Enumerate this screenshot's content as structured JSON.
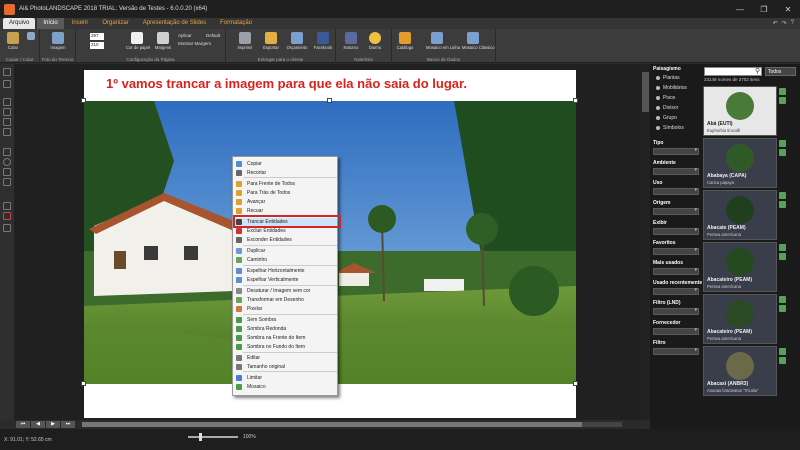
{
  "window": {
    "title": "Ai& PhotoLANDSCAPE 2018 TRIAL: Versão de Testes - 6.0.0.20 (x64)",
    "controls": [
      "—",
      "❐",
      "✕"
    ]
  },
  "menubar": {
    "tabs": [
      "Arquivo",
      "Início",
      "Inserir",
      "Organizar",
      "Apresentação de Slides",
      "Formatação"
    ],
    "active": "Início",
    "right_icons": [
      "↶",
      "↷",
      "?"
    ]
  },
  "ribbon": {
    "groups": [
      {
        "label": "Copiar / Colar",
        "buttons": [
          "Colar",
          "Copiar"
        ]
      },
      {
        "label": "Foto do Terreno",
        "buttons": [
          "Imagem"
        ]
      },
      {
        "label": "Configuração da Página",
        "buttons": [
          "Cor de papel",
          "Margens",
          "Aplicar",
          "Mostrar Margem",
          "Default"
        ],
        "width_value": "297",
        "height_value": "210"
      },
      {
        "label": "Entregar para o cliente",
        "buttons": [
          "Imprimir",
          "Exportar",
          "Orçamento",
          "Facebook"
        ]
      },
      {
        "label": "Noite/Dia",
        "buttons": [
          "Noturno",
          "Diurno"
        ]
      },
      {
        "label": "Banco de Dados",
        "buttons": [
          "Catálogo",
          "Mosaico em Linha",
          "Mosaico Clássico"
        ]
      }
    ]
  },
  "canvas": {
    "caption": "1º vamos trancar a imagem para que ela não saia do lugar."
  },
  "context_menu": {
    "items": [
      {
        "label": "Copiar",
        "color": "#4a90d9"
      },
      {
        "label": "Recortar",
        "color": "#666666"
      },
      {
        "label": "Para Frente de Todos",
        "color": "#e0a030"
      },
      {
        "label": "Para Trás de Todos",
        "color": "#e0a030"
      },
      {
        "label": "Avançar",
        "color": "#e0a030"
      },
      {
        "label": "Recuar",
        "color": "#e0a030"
      },
      {
        "label": "Trancar Entidades",
        "color": "#444444",
        "highlighted": true
      },
      {
        "label": "Excluir Entidades",
        "color": "#cc3333"
      },
      {
        "label": "Esconder Entidades",
        "color": "#666666"
      },
      {
        "label": "Duplicar",
        "color": "#6a9ad6"
      },
      {
        "label": "Caminho",
        "color": "#6aa060"
      },
      {
        "label": "Espelhar Horizontalmente",
        "color": "#5a8fd0"
      },
      {
        "label": "Espelhar Verticalmente",
        "color": "#5a8fd0"
      },
      {
        "label": "Desaturar / Imagem sem cor",
        "color": "#888888"
      },
      {
        "label": "Transformar em Desenho",
        "color": "#6aa060"
      },
      {
        "label": "Pixelar",
        "color": "#d07a3a"
      },
      {
        "label": "Sem Sombra",
        "color": "#4a9a4a"
      },
      {
        "label": "Sombra Redonda",
        "color": "#4a9a4a"
      },
      {
        "label": "Sombra na Frente do Item",
        "color": "#4a9a4a"
      },
      {
        "label": "Sombra no Fundo do Item",
        "color": "#4a9a4a"
      },
      {
        "label": "Editar",
        "color": "#777777"
      },
      {
        "label": "Tamanho original",
        "color": "#777777"
      },
      {
        "label": "Limitar",
        "color": "#4a7fcf"
      },
      {
        "label": "Mosaico",
        "color": "#4a9a4a"
      }
    ]
  },
  "side_panel": {
    "paisagismo_label": "Paisagismo",
    "categories": [
      "Plantas",
      "Mobiliários",
      "Pisos",
      "Divisor",
      "Grupo",
      "Símbolos"
    ],
    "filters": [
      "Tipo",
      "Ambiente",
      "Uso",
      "Origem",
      "Exibir",
      "Favoritos",
      "Mais usados",
      "Usado recentemente",
      "Filtro (LND)",
      "Fornecedor",
      "Filtro"
    ],
    "search_placeholder": "",
    "scope": "Todos",
    "count_text": "23149 nomes de 2702 itens",
    "items": [
      {
        "name": "Abá (EUTI)",
        "scientific": "Euphorbia tirucalli",
        "selected": true
      },
      {
        "name": "Ababaya (CAPA)",
        "scientific": "Carica papaya",
        "selected": false
      },
      {
        "name": "Abacate (PEAM)",
        "scientific": "Persea americana",
        "selected": false
      },
      {
        "name": "Abacateiro (PEAM)",
        "scientific": "Persea americana",
        "selected": false
      },
      {
        "name": "Abacateiro (PEAM)",
        "scientific": "Persea americana",
        "selected": false
      },
      {
        "name": "Abacaxi (ANBR3)",
        "scientific": "Ananas bracteatus 'Tricolor'",
        "selected": false
      }
    ]
  },
  "statusbar": {
    "coords": "X: 91.01; Y: 52.65 cm",
    "zoom": "100%"
  },
  "colors": {
    "accent_orange": "#e6a23c",
    "caption_red": "#d9221c",
    "highlight_box": "#d0262c"
  }
}
